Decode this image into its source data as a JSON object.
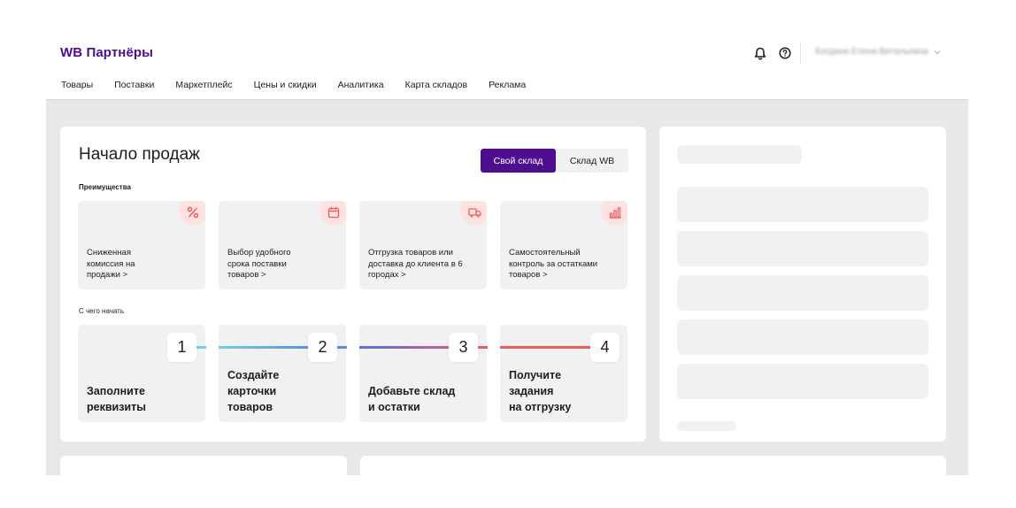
{
  "header": {
    "logo": "WB Партнёры",
    "user_name": "Богдана Елена Витальевна",
    "icons": [
      "bell-icon",
      "help-icon",
      "chevron-down-icon"
    ]
  },
  "nav": [
    {
      "label": "Товары"
    },
    {
      "label": "Поставки"
    },
    {
      "label": "Маркетплейс"
    },
    {
      "label": "Цены и скидки"
    },
    {
      "label": "Аналитика"
    },
    {
      "label": "Карта складов"
    },
    {
      "label": "Реклама"
    }
  ],
  "main": {
    "title": "Начало продаж",
    "toggle": {
      "active": "Свой склад",
      "inactive": "Склад WB"
    },
    "advantages_label": "Преимущества",
    "advantages": [
      {
        "text": "Сниженная комиссия на продажи >",
        "icon": "percent-icon"
      },
      {
        "text": "Выбор удобного срока поставки товаров >",
        "icon": "calendar-icon"
      },
      {
        "text": "Отгрузка товаров или доставка до клиента в 6 городах >",
        "icon": "truck-icon"
      },
      {
        "text": "Самостоятельный контроль за остатками товаров >",
        "icon": "bar-chart-icon"
      }
    ],
    "start_label": "С чего начать",
    "steps": [
      {
        "num": "1",
        "text": "Заполните\nреквизиты"
      },
      {
        "num": "2",
        "text": "Создайте\nкарточки\nтоваров"
      },
      {
        "num": "3",
        "text": "Добавьте склад\nи остатки"
      },
      {
        "num": "4",
        "text": "Получите\nзадания\nна отгрузку"
      }
    ]
  },
  "colors": {
    "brand": "#4f0e8f",
    "accent_red": "#f25c5c",
    "step_line_1": "#6fd3d6",
    "step_line_2": "#5b8fe0",
    "step_line_3": "#7b5cd9",
    "step_line_4": "#f05a5a"
  }
}
